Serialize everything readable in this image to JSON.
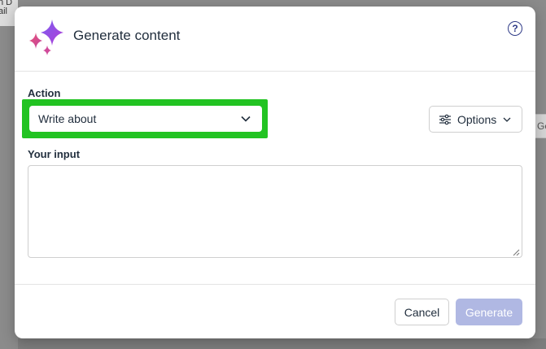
{
  "background": {
    "top_left_text_line1": "n D",
    "top_left_text_line2": "ail",
    "right_text": "Ge"
  },
  "dialog": {
    "title": "Generate content",
    "help_label": "?",
    "action_label": "Action",
    "action_selected": "Write about",
    "options_label": "Options",
    "input_label": "Your input",
    "input_value": "",
    "cancel_label": "Cancel",
    "generate_label": "Generate"
  },
  "colors": {
    "highlight": "#22c322",
    "generate_disabled": "#b0b8e3",
    "help_icon": "#2e3a87"
  },
  "icons": {
    "logo": "sparkle-stars-icon",
    "help": "question-circle-icon",
    "dropdown": "chevron-down-icon",
    "options": "sliders-icon",
    "resize": "resize-grip-icon"
  }
}
